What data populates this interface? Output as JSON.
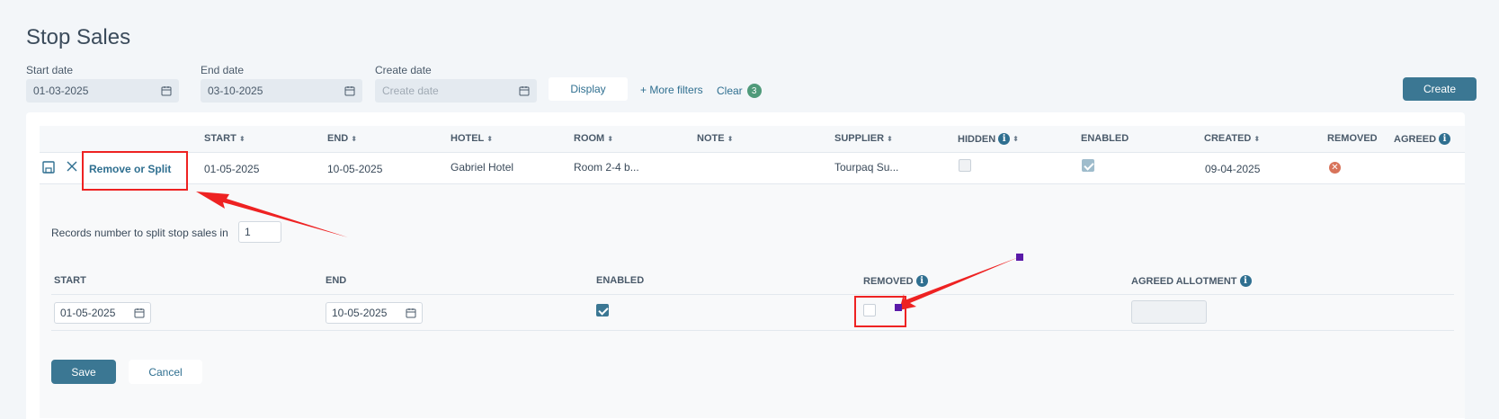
{
  "page": {
    "title": "Stop Sales"
  },
  "filters": {
    "start_date": {
      "label": "Start date",
      "value": "01-03-2025"
    },
    "end_date": {
      "label": "End date",
      "value": "03-10-2025"
    },
    "create_date": {
      "label": "Create date",
      "placeholder": "Create date"
    },
    "display_label": "Display",
    "more_filters_label": "+ More filters",
    "clear_label": "Clear",
    "clear_count": "3"
  },
  "toolbar": {
    "create_label": "Create"
  },
  "table": {
    "columns": {
      "start": "START",
      "end": "END",
      "hotel": "HOTEL",
      "room": "ROOM",
      "note": "NOTE",
      "supplier": "SUPPLIER",
      "hidden": "HIDDEN",
      "enabled": "ENABLED",
      "created": "CREATED",
      "removed": "REMOVED",
      "agreed": "AGREED"
    },
    "row": {
      "action_label": "Remove or Split",
      "start": "01-05-2025",
      "end": "10-05-2025",
      "hotel": "Gabriel Hotel",
      "room": "Room 2-4 b...",
      "note": "",
      "supplier": "Tourpaq Su...",
      "hidden": false,
      "enabled": true,
      "created": "09-04-2025",
      "removed": true
    }
  },
  "split": {
    "records_label": "Records number to split stop sales in",
    "records_value": "1",
    "columns": {
      "start": "START",
      "end": "END",
      "enabled": "ENABLED",
      "removed": "REMOVED",
      "agreed_allotment": "AGREED ALLOTMENT"
    },
    "row": {
      "start": "01-05-2025",
      "end": "10-05-2025",
      "enabled": true,
      "removed": false,
      "agreed_allotment": ""
    },
    "save_label": "Save",
    "cancel_label": "Cancel"
  },
  "colors": {
    "primary": "#3b7793",
    "annotation": "#ee2222",
    "marker": "#5a1aa8"
  }
}
